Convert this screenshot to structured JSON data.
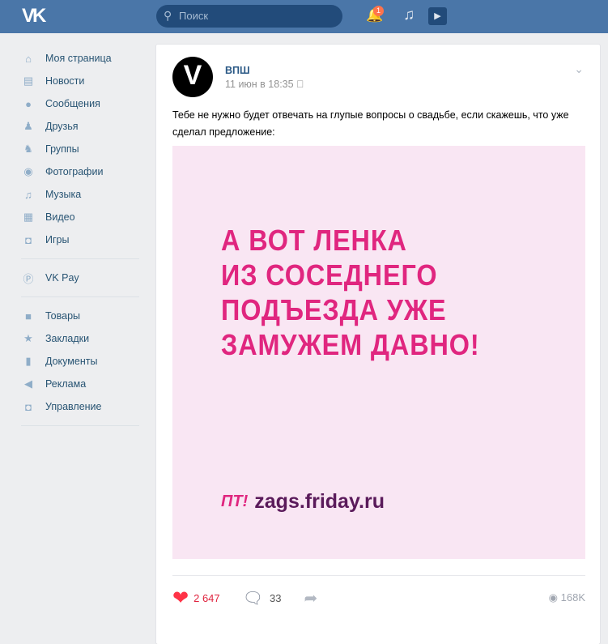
{
  "header": {
    "logo": "VK",
    "search_placeholder": "Поиск",
    "notifications_count": "1"
  },
  "sidebar": {
    "items": [
      {
        "label": "Моя страница",
        "icon": "home-icon"
      },
      {
        "label": "Новости",
        "icon": "news-icon"
      },
      {
        "label": "Сообщения",
        "icon": "messages-icon"
      },
      {
        "label": "Друзья",
        "icon": "friends-icon"
      },
      {
        "label": "Группы",
        "icon": "groups-icon"
      },
      {
        "label": "Фотографии",
        "icon": "camera-icon"
      },
      {
        "label": "Музыка",
        "icon": "music-icon"
      },
      {
        "label": "Видео",
        "icon": "video-icon"
      },
      {
        "label": "Игры",
        "icon": "gamepad-icon"
      }
    ],
    "pay": {
      "label": "VK Pay"
    },
    "extra": [
      {
        "label": "Товары",
        "icon": "bag-icon"
      },
      {
        "label": "Закладки",
        "icon": "star-icon"
      },
      {
        "label": "Документы",
        "icon": "document-icon"
      },
      {
        "label": "Реклама",
        "icon": "megaphone-icon"
      },
      {
        "label": "Управление",
        "icon": "gamepad-icon"
      }
    ]
  },
  "post": {
    "author": "ВПШ",
    "date": "11 июн в 18:35",
    "text": "Тебе не нужно будет отвечать на глупые вопросы о свадьбе, если скажешь, что уже сделал предложение:",
    "image": {
      "lines": [
        "А вот Ленка",
        "из соседнего",
        "подъезда уже",
        "замужем давно!"
      ],
      "brand": "ПТ!",
      "url": "zags.friday.ru"
    },
    "likes": "2 647",
    "comments": "33",
    "views": "168K"
  }
}
